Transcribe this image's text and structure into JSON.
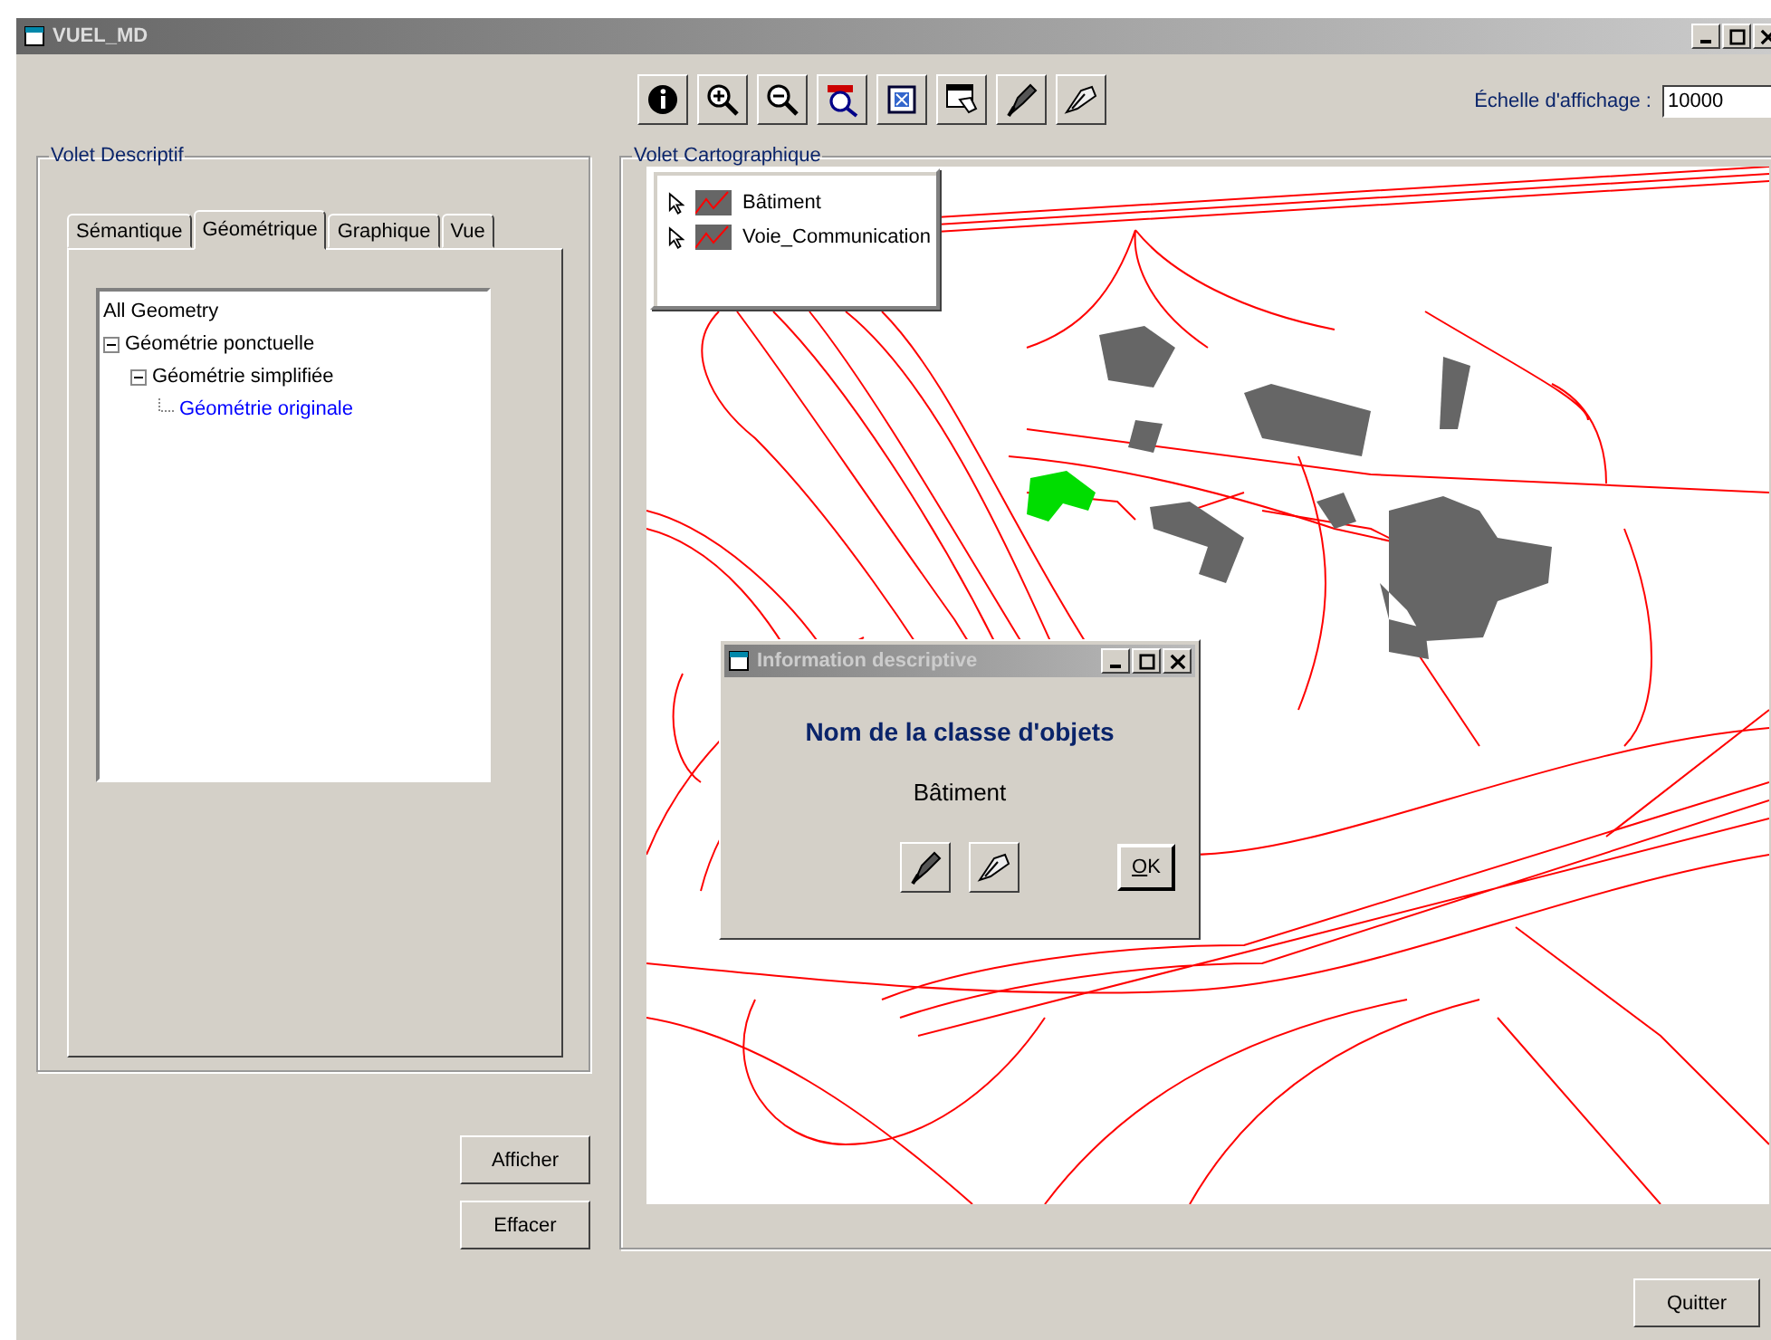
{
  "window": {
    "title": "VUEL_MD"
  },
  "scale": {
    "label": "Échelle d'affichage :",
    "value": "10000"
  },
  "descriptive_panel": {
    "title": "Volet Descriptif",
    "tabs": [
      {
        "label": "Sémantique",
        "selected": false
      },
      {
        "label": "Géométrique",
        "selected": true
      },
      {
        "label": "Graphique",
        "selected": false
      },
      {
        "label": "Vue",
        "selected": false
      }
    ],
    "tree": [
      {
        "label": "All Geometry",
        "selected": false
      },
      {
        "label": "Géométrie ponctuelle",
        "selected": false,
        "expanded": true,
        "children": [
          {
            "label": "Géométrie simplifiée",
            "selected": false,
            "expanded": true,
            "children": [
              {
                "label": "Géométrie originale",
                "selected": true
              }
            ]
          }
        ]
      }
    ],
    "buttons": [
      "Afficher",
      "Effacer"
    ]
  },
  "map_panel": {
    "title": "Volet Cartographique",
    "legend": [
      {
        "label": "Bâtiment"
      },
      {
        "label": "Voie_Communication"
      }
    ]
  },
  "dialog": {
    "title": "Information descriptive",
    "heading": "Nom de la classe d'objets",
    "value": "Bâtiment",
    "ok": "OK"
  },
  "quit_button": "Quitter"
}
